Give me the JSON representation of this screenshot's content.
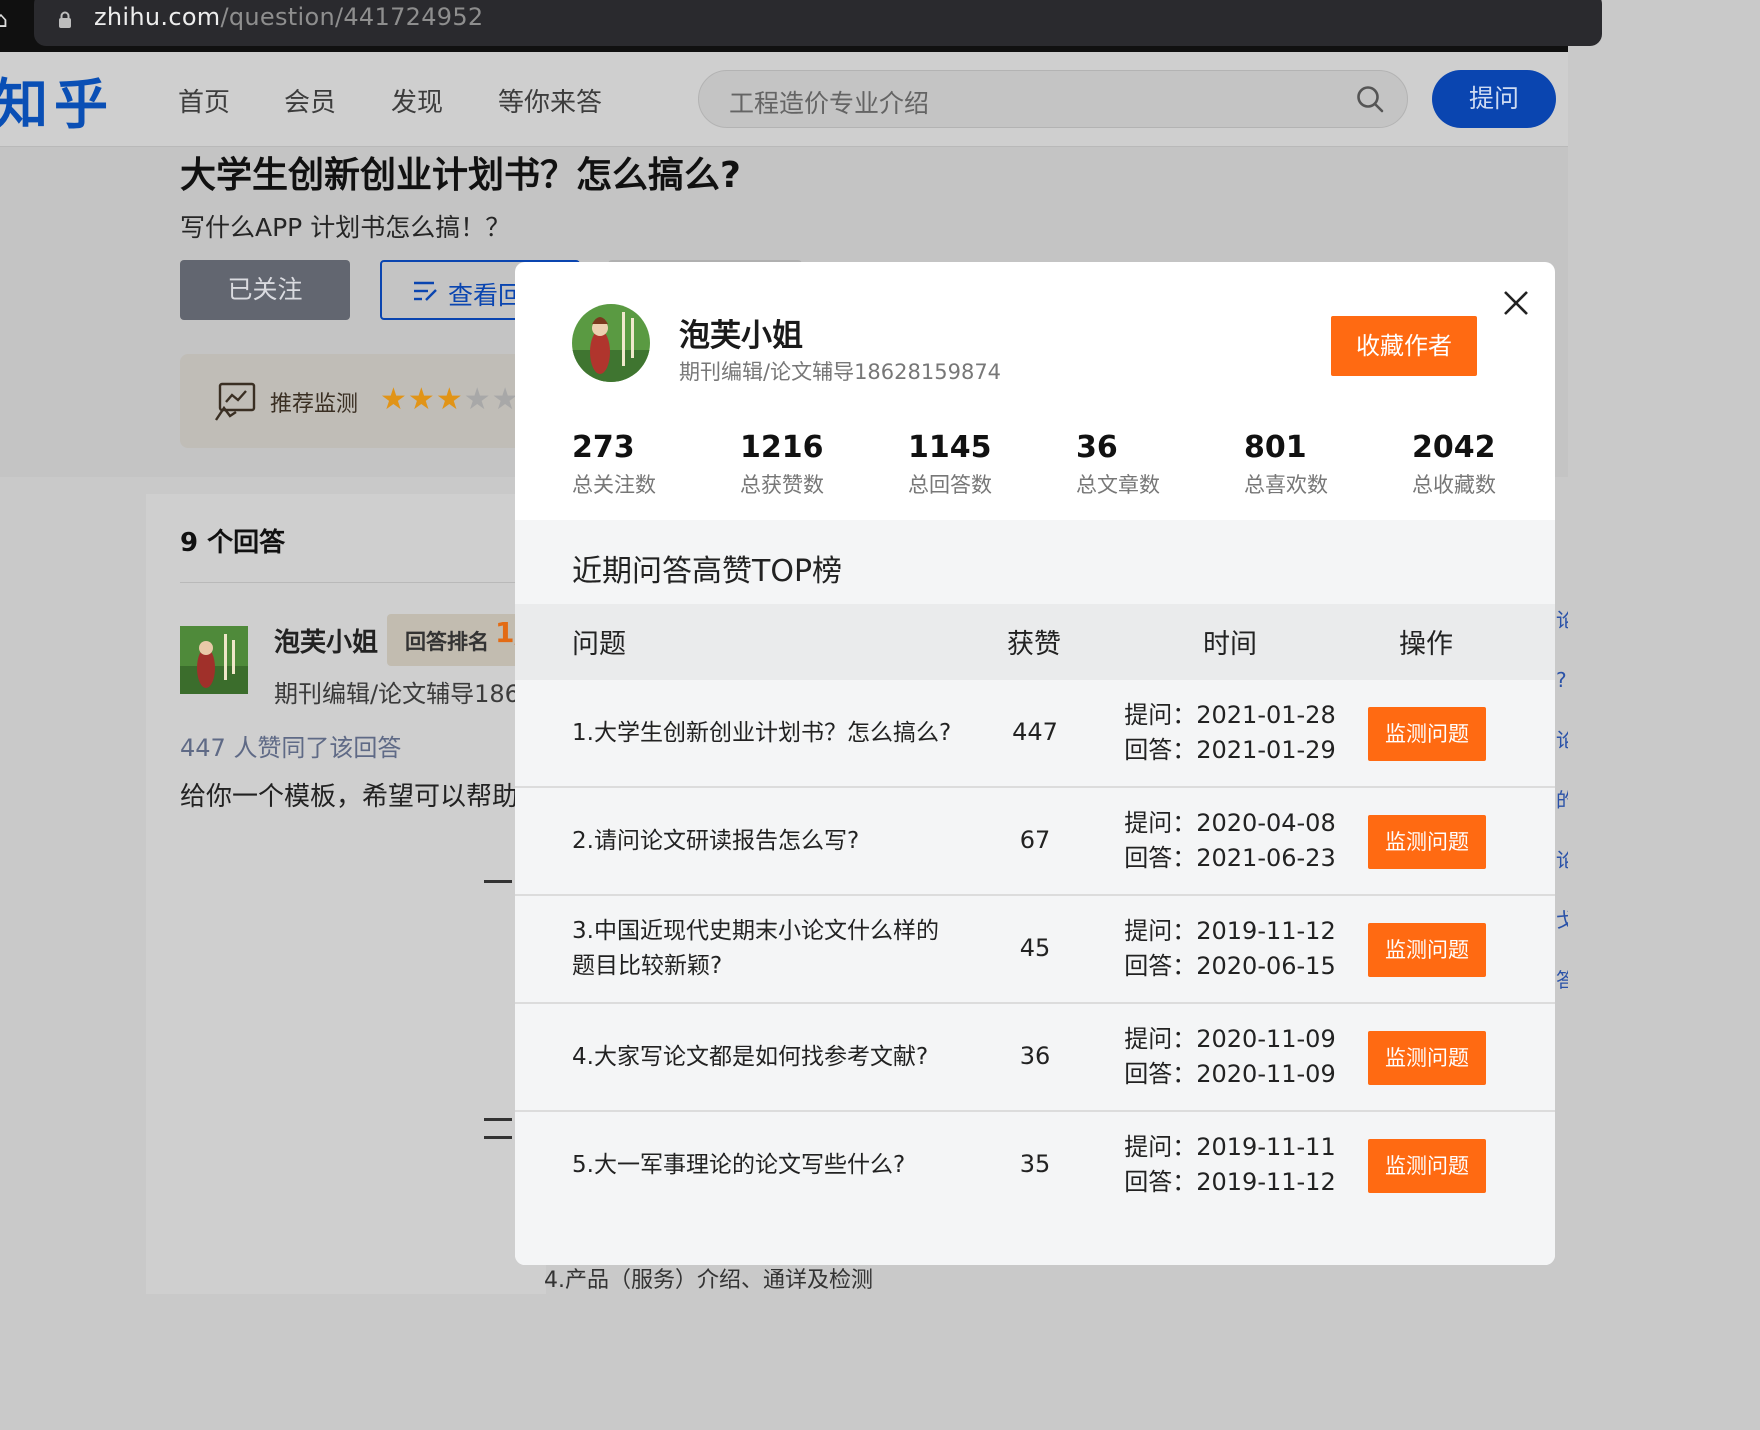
{
  "browser": {
    "url_host": "zhihu.com",
    "url_path": "/question/441724952"
  },
  "header": {
    "logo": "知乎",
    "nav": [
      "首页",
      "会员",
      "发现",
      "等你来答"
    ],
    "search_placeholder": "工程造价专业介绍",
    "ask_button": "提问"
  },
  "question": {
    "title": "大学生创新创业计划书？怎么搞么?",
    "description": "写什么APP 计划书怎么搞！？",
    "followed_button": "已关注",
    "view_button": "查看回",
    "recommend_label": "推荐监测",
    "recommend_stars": 3
  },
  "answers": {
    "count_label": "9 个回答",
    "author": "泡芙小姐",
    "rank_label": "回答排名",
    "rank_value": "1/",
    "bio": "期刊编辑/论文辅导186",
    "votes_text": "447 人赞同了该回答",
    "excerpt": "给你一个模板，希望可以帮助",
    "footer_fragment": "4.产品（服务）介绍、通详及检测"
  },
  "right_strip": [
    "论",
    "?",
    "论",
    "",
    "的",
    "",
    "论",
    "戈",
    "答"
  ],
  "modal": {
    "author_name": "泡芙小姐",
    "author_bio": "期刊编辑/论文辅导18628159874",
    "fav_button": "收藏作者",
    "stats": [
      {
        "value": "273",
        "label": "总关注数"
      },
      {
        "value": "1216",
        "label": "总获赞数"
      },
      {
        "value": "1145",
        "label": "总回答数"
      },
      {
        "value": "36",
        "label": "总文章数"
      },
      {
        "value": "801",
        "label": "总喜欢数"
      },
      {
        "value": "2042",
        "label": "总收藏数"
      }
    ],
    "section_title": "近期问答高赞TOP榜",
    "table_headers": [
      "问题",
      "获赞",
      "时间",
      "操作"
    ],
    "rows": [
      {
        "question": "1.大学生创新创业计划书？怎么搞么?",
        "votes": "447",
        "asked": "提问：2021-01-28",
        "answered": "回答：2021-01-29",
        "action": "监测问题"
      },
      {
        "question": "2.请问论文研读报告怎么写?",
        "votes": "67",
        "asked": "提问：2020-04-08",
        "answered": "回答：2021-06-23",
        "action": "监测问题"
      },
      {
        "question": "3.中国近现代史期末小论文什么样的题目比较新颖?",
        "votes": "45",
        "asked": "提问：2019-11-12",
        "answered": "回答：2020-06-15",
        "action": "监测问题"
      },
      {
        "question": "4.大家写论文都是如何找参考文献?",
        "votes": "36",
        "asked": "提问：2020-11-09",
        "answered": "回答：2020-11-09",
        "action": "监测问题"
      },
      {
        "question": "5.大一军事理论的论文写些什么?",
        "votes": "35",
        "asked": "提问：2019-11-11",
        "answered": "回答：2019-11-12",
        "action": "监测问题"
      }
    ]
  },
  "colors": {
    "brand_blue": "#0a45b0",
    "action_orange": "#ff6a12",
    "star": "#e19417"
  }
}
